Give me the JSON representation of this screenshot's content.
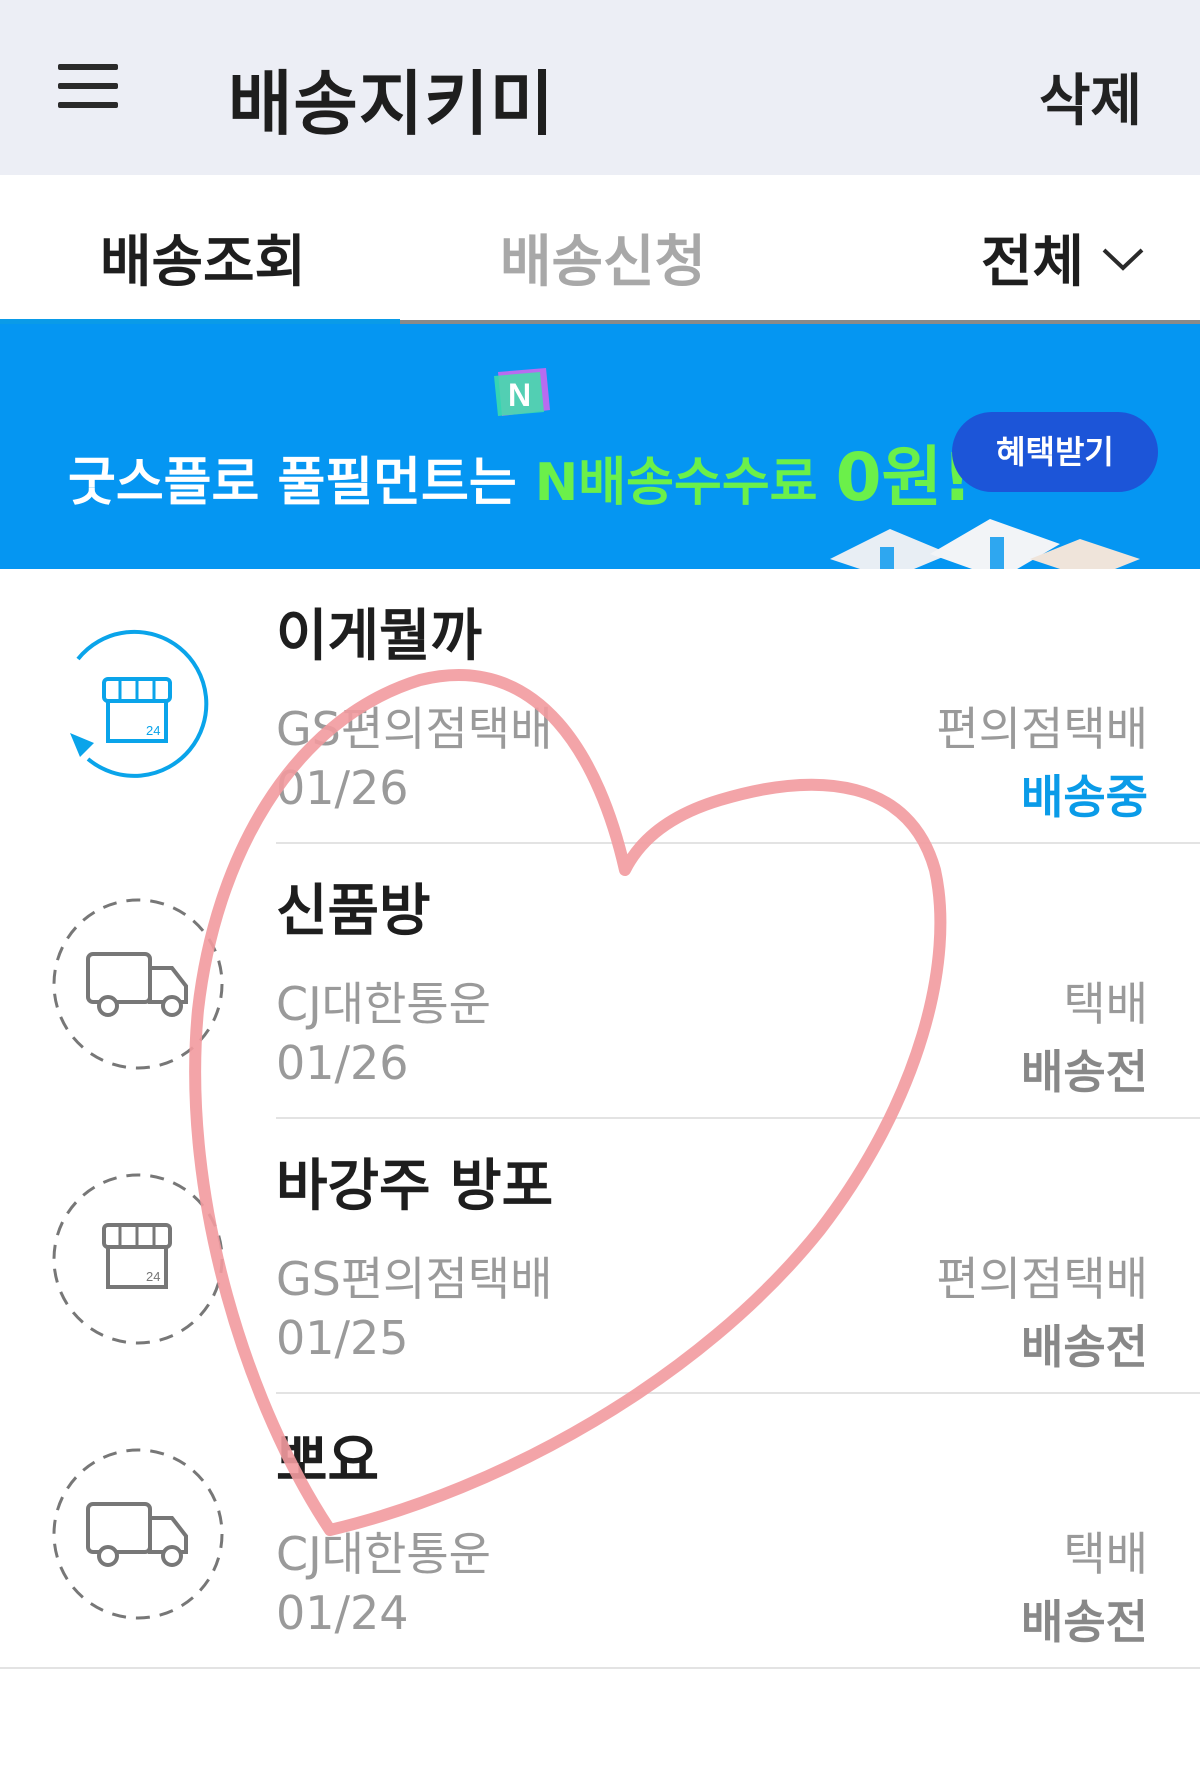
{
  "header": {
    "title": "배송지키미",
    "delete_label": "삭제"
  },
  "tabs": {
    "items": [
      {
        "label": "배송조회",
        "active": true
      },
      {
        "label": "배송신청",
        "active": false
      }
    ],
    "filter_label": "전체"
  },
  "banner": {
    "text_main": "굿스플로 풀필먼트는 ",
    "text_highlight": "N배송수수료 ",
    "text_zero": "0원!",
    "button_label": "혜택받기",
    "badge_letter": "N"
  },
  "shipments": [
    {
      "name": "이게뭘까",
      "courier": "GS편의점택배",
      "date": "01/26",
      "type": "편의점택배",
      "status": "배송중",
      "icon": "store-icon",
      "active": true
    },
    {
      "name": "신품방",
      "courier": "CJ대한통운",
      "date": "01/26",
      "type": "택배",
      "status": "배송전",
      "icon": "truck-icon",
      "active": false
    },
    {
      "name": "바강주 방포",
      "courier": "GS편의점택배",
      "date": "01/25",
      "type": "편의점택배",
      "status": "배송전",
      "icon": "store-icon",
      "active": false
    },
    {
      "name": "뽀요",
      "courier": "CJ대한통운",
      "date": "01/24",
      "type": "택배",
      "status": "배송전",
      "icon": "truck-icon",
      "active": false
    }
  ],
  "colors": {
    "accent": "#0a9be8",
    "banner_bg": "#0596f2",
    "banner_highlight": "#6bf04a",
    "heart_stroke": "#f29a9e"
  }
}
